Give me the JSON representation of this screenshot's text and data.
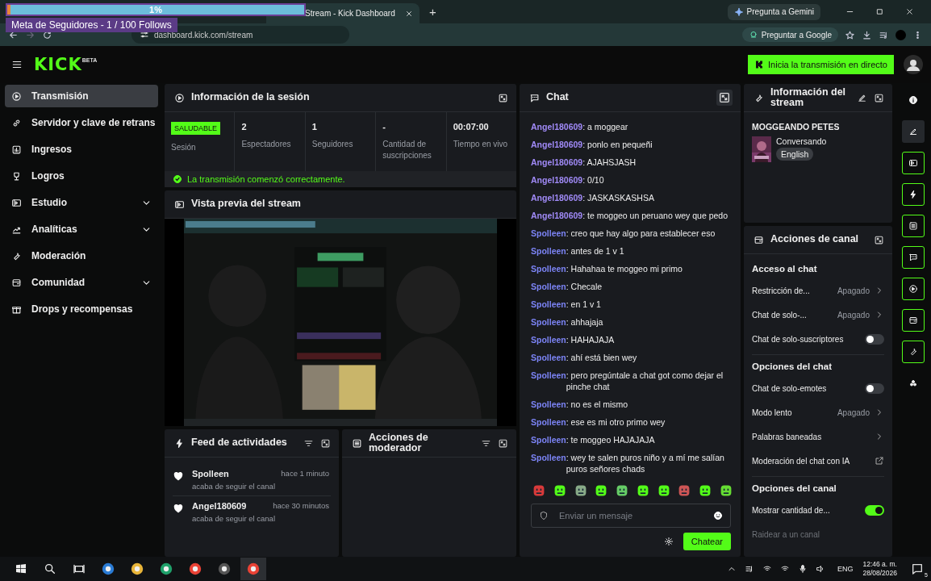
{
  "goal_overlay": {
    "percent": "1%",
    "level": 0.01,
    "title": "Meta de Seguidores - 1 / 100 Follows"
  },
  "browser": {
    "tab_title": "Stream - Kick Dashboard",
    "new_tab": "+",
    "gemini_button": "Pregunta a Gemini",
    "url": "dashboard.kick.com/stream",
    "google_button": "Preguntar a Google"
  },
  "header": {
    "logo": "KICK",
    "logo_badge": "BETA",
    "go_live_button": "Inicia la transmisión en directo"
  },
  "sidebar": {
    "items": [
      {
        "label": "Transmisión",
        "selected": true,
        "expandable": false
      },
      {
        "label": "Servidor y clave de retrans",
        "selected": false,
        "expandable": false
      },
      {
        "label": "Ingresos",
        "selected": false,
        "expandable": false
      },
      {
        "label": "Logros",
        "selected": false,
        "expandable": false
      },
      {
        "label": "Estudio",
        "selected": false,
        "expandable": true
      },
      {
        "label": "Analíticas",
        "selected": false,
        "expandable": true
      },
      {
        "label": "Moderación",
        "selected": false,
        "expandable": false
      },
      {
        "label": "Comunidad",
        "selected": false,
        "expandable": true
      },
      {
        "label": "Drops y recompensas",
        "selected": false,
        "expandable": false
      }
    ]
  },
  "session_panel": {
    "title": "Información de la sesión",
    "stats": [
      {
        "kind": "badge",
        "value": "SALUDABLE",
        "label": "Sesión"
      },
      {
        "kind": "number",
        "value": "2",
        "label": "Espectadores"
      },
      {
        "kind": "number",
        "value": "1",
        "label": "Seguidores"
      },
      {
        "kind": "number",
        "value": "-",
        "label": "Cantidad de suscripciones"
      },
      {
        "kind": "number",
        "value": "00:07:00",
        "label": "Tiempo en vivo"
      }
    ],
    "status": "La transmisión comenzó correctamente."
  },
  "preview_panel": {
    "title": "Vista previa del stream"
  },
  "activity_feed": {
    "title": "Feed de actividades",
    "items": [
      {
        "user": "Spolleen",
        "time": "hace 1 minuto",
        "text": "acaba de seguir el canal"
      },
      {
        "user": "Angel180609",
        "time": "hace 30 minutos",
        "text": "acaba de seguir el canal"
      }
    ]
  },
  "moderator_panel": {
    "title": "Acciones de moderador"
  },
  "chat": {
    "title": "Chat",
    "messages": [
      {
        "user": "Angel180609",
        "color": "#a08af7",
        "text": ": a moggear"
      },
      {
        "user": "Angel180609",
        "color": "#a08af7",
        "text": ": ponlo en pequeñi"
      },
      {
        "user": "Angel180609",
        "color": "#a08af7",
        "text": ": AJAHSJASH"
      },
      {
        "user": "Angel180609",
        "color": "#a08af7",
        "text": ": 0/10"
      },
      {
        "user": "Angel180609",
        "color": "#a08af7",
        "text": ": JASKASKASHSA"
      },
      {
        "user": "Angel180609",
        "color": "#a08af7",
        "text": ": te moggeo un peruano wey que pedo"
      },
      {
        "user": "Spolleen",
        "color": "#7c84f6",
        "text": ": creo que hay algo para establecer eso"
      },
      {
        "user": "Spolleen",
        "color": "#7c84f6",
        "text": ": antes de 1 v 1"
      },
      {
        "user": "Spolleen",
        "color": "#7c84f6",
        "text": ": Hahahaa te moggeo mi primo"
      },
      {
        "user": "Spolleen",
        "color": "#7c84f6",
        "text": ": Checale"
      },
      {
        "user": "Spolleen",
        "color": "#7c84f6",
        "text": ": en 1 v 1"
      },
      {
        "user": "Spolleen",
        "color": "#7c84f6",
        "text": ": ahhajaja"
      },
      {
        "user": "Spolleen",
        "color": "#7c84f6",
        "text": ": HAHAJAJA"
      },
      {
        "user": "Spolleen",
        "color": "#7c84f6",
        "text": ": ahí está bien wey"
      },
      {
        "user": "Spolleen",
        "color": "#7c84f6",
        "text": ": pero pregúntale a chat got como dejar el pinche chat"
      },
      {
        "user": "Spolleen",
        "color": "#7c84f6",
        "text": ": no es el mismo"
      },
      {
        "user": "Spolleen",
        "color": "#7c84f6",
        "text": ": ese es mi otro primo wey"
      },
      {
        "user": "Spolleen",
        "color": "#7c84f6",
        "text": ": te moggeo HAJAJAJA"
      },
      {
        "user": "Spolleen",
        "color": "#7c84f6",
        "text": ": wey te salen puros niño y a mí me salían puros señores chads"
      }
    ],
    "input": {
      "placeholder": "Enviar un mensaje"
    },
    "send_button": "Chatear"
  },
  "stream_info": {
    "title": "Información del stream",
    "stream_title": "MOGGEANDO PETES",
    "category": "Conversando",
    "tags": [
      "English"
    ]
  },
  "channel_actions": {
    "title": "Acciones de canal",
    "sections": [
      {
        "title": "Acceso al chat",
        "rows": [
          {
            "kind": "menu",
            "label": "Restricción de...",
            "value": "Apagado",
            "disabled": false
          },
          {
            "kind": "menu",
            "label": "Chat de solo-...",
            "value": "Apagado",
            "disabled": false
          },
          {
            "kind": "toggle",
            "label": "Chat de solo-suscriptores",
            "on": false,
            "disabled": false
          }
        ]
      },
      {
        "title": "Opciones del chat",
        "rows": [
          {
            "kind": "toggle",
            "label": "Chat de solo-emotes",
            "on": false,
            "disabled": false
          },
          {
            "kind": "menu",
            "label": "Modo lento",
            "value": "Apagado",
            "disabled": false
          },
          {
            "kind": "menu",
            "label": "Palabras baneadas",
            "disabled": false
          },
          {
            "kind": "link",
            "label": "Moderación del chat con IA",
            "disabled": false
          }
        ]
      },
      {
        "title": "Opciones del canal",
        "rows": [
          {
            "kind": "toggle",
            "label": "Mostrar cantidad de...",
            "on": true,
            "disabled": false
          },
          {
            "kind": "action",
            "label": "Raidear a un canal",
            "disabled": true
          }
        ]
      }
    ]
  },
  "rail_buttons": [
    {
      "active": false,
      "selected": false
    },
    {
      "active": false,
      "selected": true
    },
    {
      "active": true,
      "selected": false
    },
    {
      "active": true,
      "selected": false
    },
    {
      "active": true,
      "selected": false
    },
    {
      "active": true,
      "selected": false
    },
    {
      "active": true,
      "selected": false
    },
    {
      "active": true,
      "selected": false
    },
    {
      "active": true,
      "selected": false
    },
    {
      "active": false,
      "selected": false
    }
  ],
  "taskbar": {
    "apps": [
      {
        "active": false
      },
      {
        "active": false
      },
      {
        "active": false
      },
      {
        "active": false
      },
      {
        "active": false
      },
      {
        "active": true
      }
    ],
    "language": "ENG",
    "time": "12:46 a. m.",
    "date": "28/08/2026",
    "notifications": "5"
  }
}
